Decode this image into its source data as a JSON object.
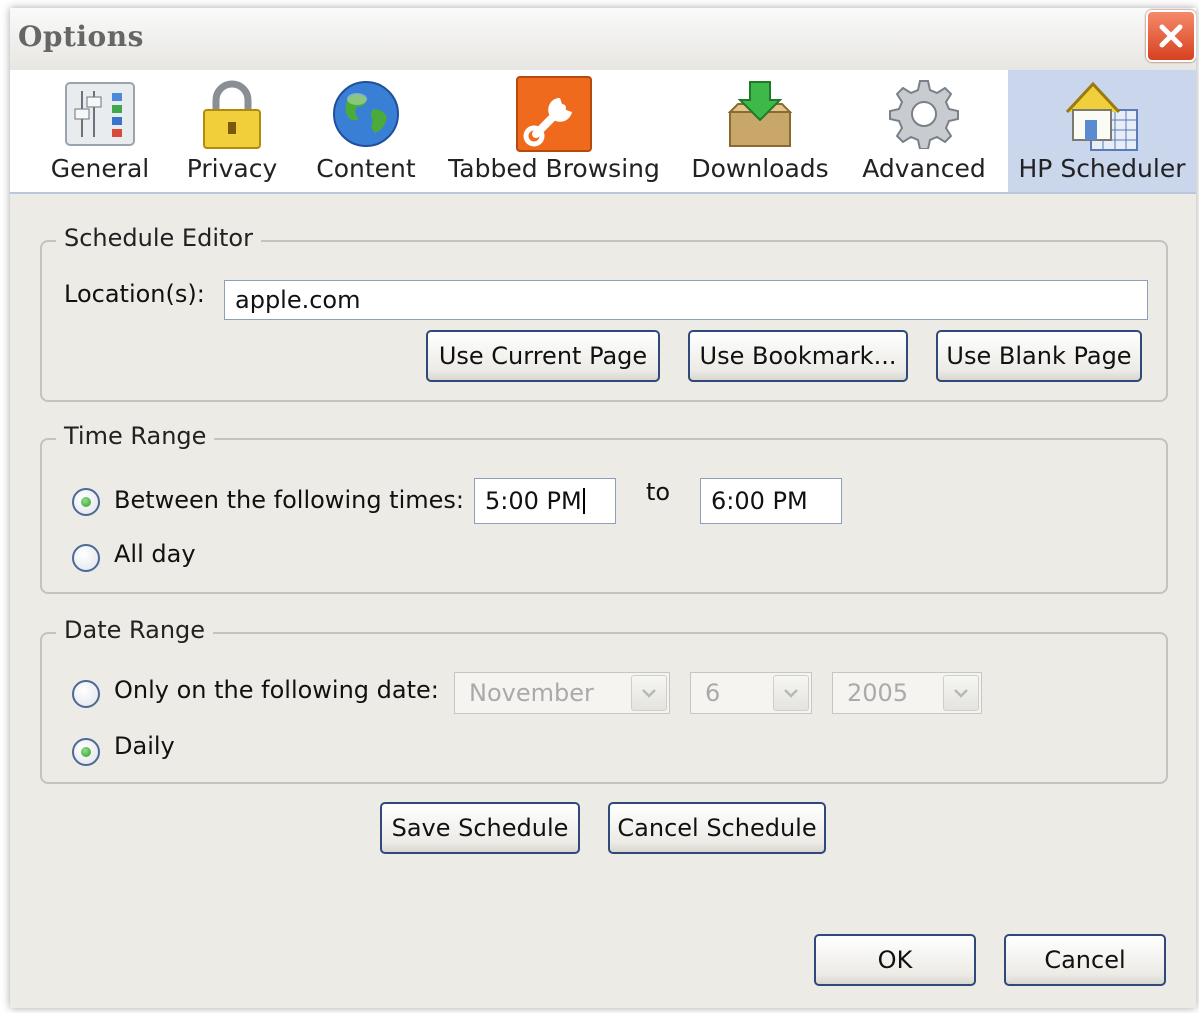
{
  "window": {
    "title": "Options",
    "close_icon": "close-icon"
  },
  "toolbar": {
    "panes": [
      {
        "label": "General",
        "icon": "general-sliders-icon"
      },
      {
        "label": "Privacy",
        "icon": "padlock-icon"
      },
      {
        "label": "Content",
        "icon": "globe-icon"
      },
      {
        "label": "Tabbed Browsing",
        "icon": "wrench-icon"
      },
      {
        "label": "Downloads",
        "icon": "download-box-icon"
      },
      {
        "label": "Advanced",
        "icon": "gear-icon"
      },
      {
        "label": "HP Scheduler",
        "icon": "house-calendar-icon"
      }
    ],
    "selected": "HP Scheduler"
  },
  "schedule_editor": {
    "legend": "Schedule Editor",
    "location_label": "Location(s):",
    "location_value": "apple.com",
    "use_current_page": "Use Current Page",
    "use_bookmark": "Use Bookmark...",
    "use_blank_page": "Use Blank Page"
  },
  "time_range": {
    "legend": "Time Range",
    "between_label": "Between the following times:",
    "between_selected": true,
    "start_time": "5:00 PM",
    "to_label": "to",
    "end_time": "6:00 PM",
    "all_day_label": "All day",
    "all_day_selected": false
  },
  "date_range": {
    "legend": "Date Range",
    "only_on_label": "Only on the following date:",
    "only_on_selected": false,
    "month": "November",
    "day": "6",
    "year": "2005",
    "daily_label": "Daily",
    "daily_selected": true
  },
  "schedule_buttons": {
    "save": "Save Schedule",
    "cancel": "Cancel Schedule"
  },
  "dialog_buttons": {
    "ok": "OK",
    "cancel": "Cancel"
  },
  "colors": {
    "selected_pane": "#c9d6ec",
    "dialog_bg": "#ecebe6",
    "close_button": "#d8411f",
    "radio_dot": "#2c9a25"
  }
}
